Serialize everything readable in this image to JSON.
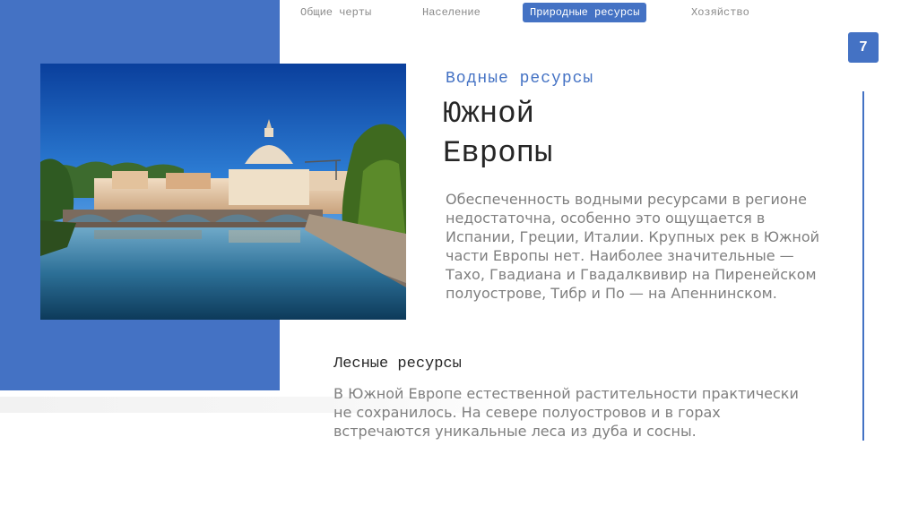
{
  "nav": {
    "items": [
      {
        "label": "Общие черты"
      },
      {
        "label": "Население"
      },
      {
        "label": "Природные ресурсы"
      },
      {
        "label": "Хозяйство"
      }
    ],
    "active_index": 2
  },
  "page_number": "7",
  "water": {
    "subtitle": "Водные ресурсы",
    "title_line1": "Южной",
    "title_line2": "Европы",
    "text": "Обеспеченность водными ресурсами в регионе недостаточна, особенно это ощущается в Испании, Греции, Италии. Крупных рек в Южной части Европы нет. Наиболее значительные — Тахо, Гвадиана и Гвадалквивир на Пиренейском полуострове, Тибр и По — на Апеннинском."
  },
  "forest": {
    "heading": "Лесные ресурсы",
    "text": "В Южной Европе естественной растительности практически не сохранилось. На севере полуостровов и в горах встречаются уникальные леса из дуба и сосны."
  },
  "colors": {
    "accent": "#4472c4",
    "text_dark": "#262626",
    "text_grey": "#7f7f7f",
    "nav_grey": "#8a8a8a"
  }
}
